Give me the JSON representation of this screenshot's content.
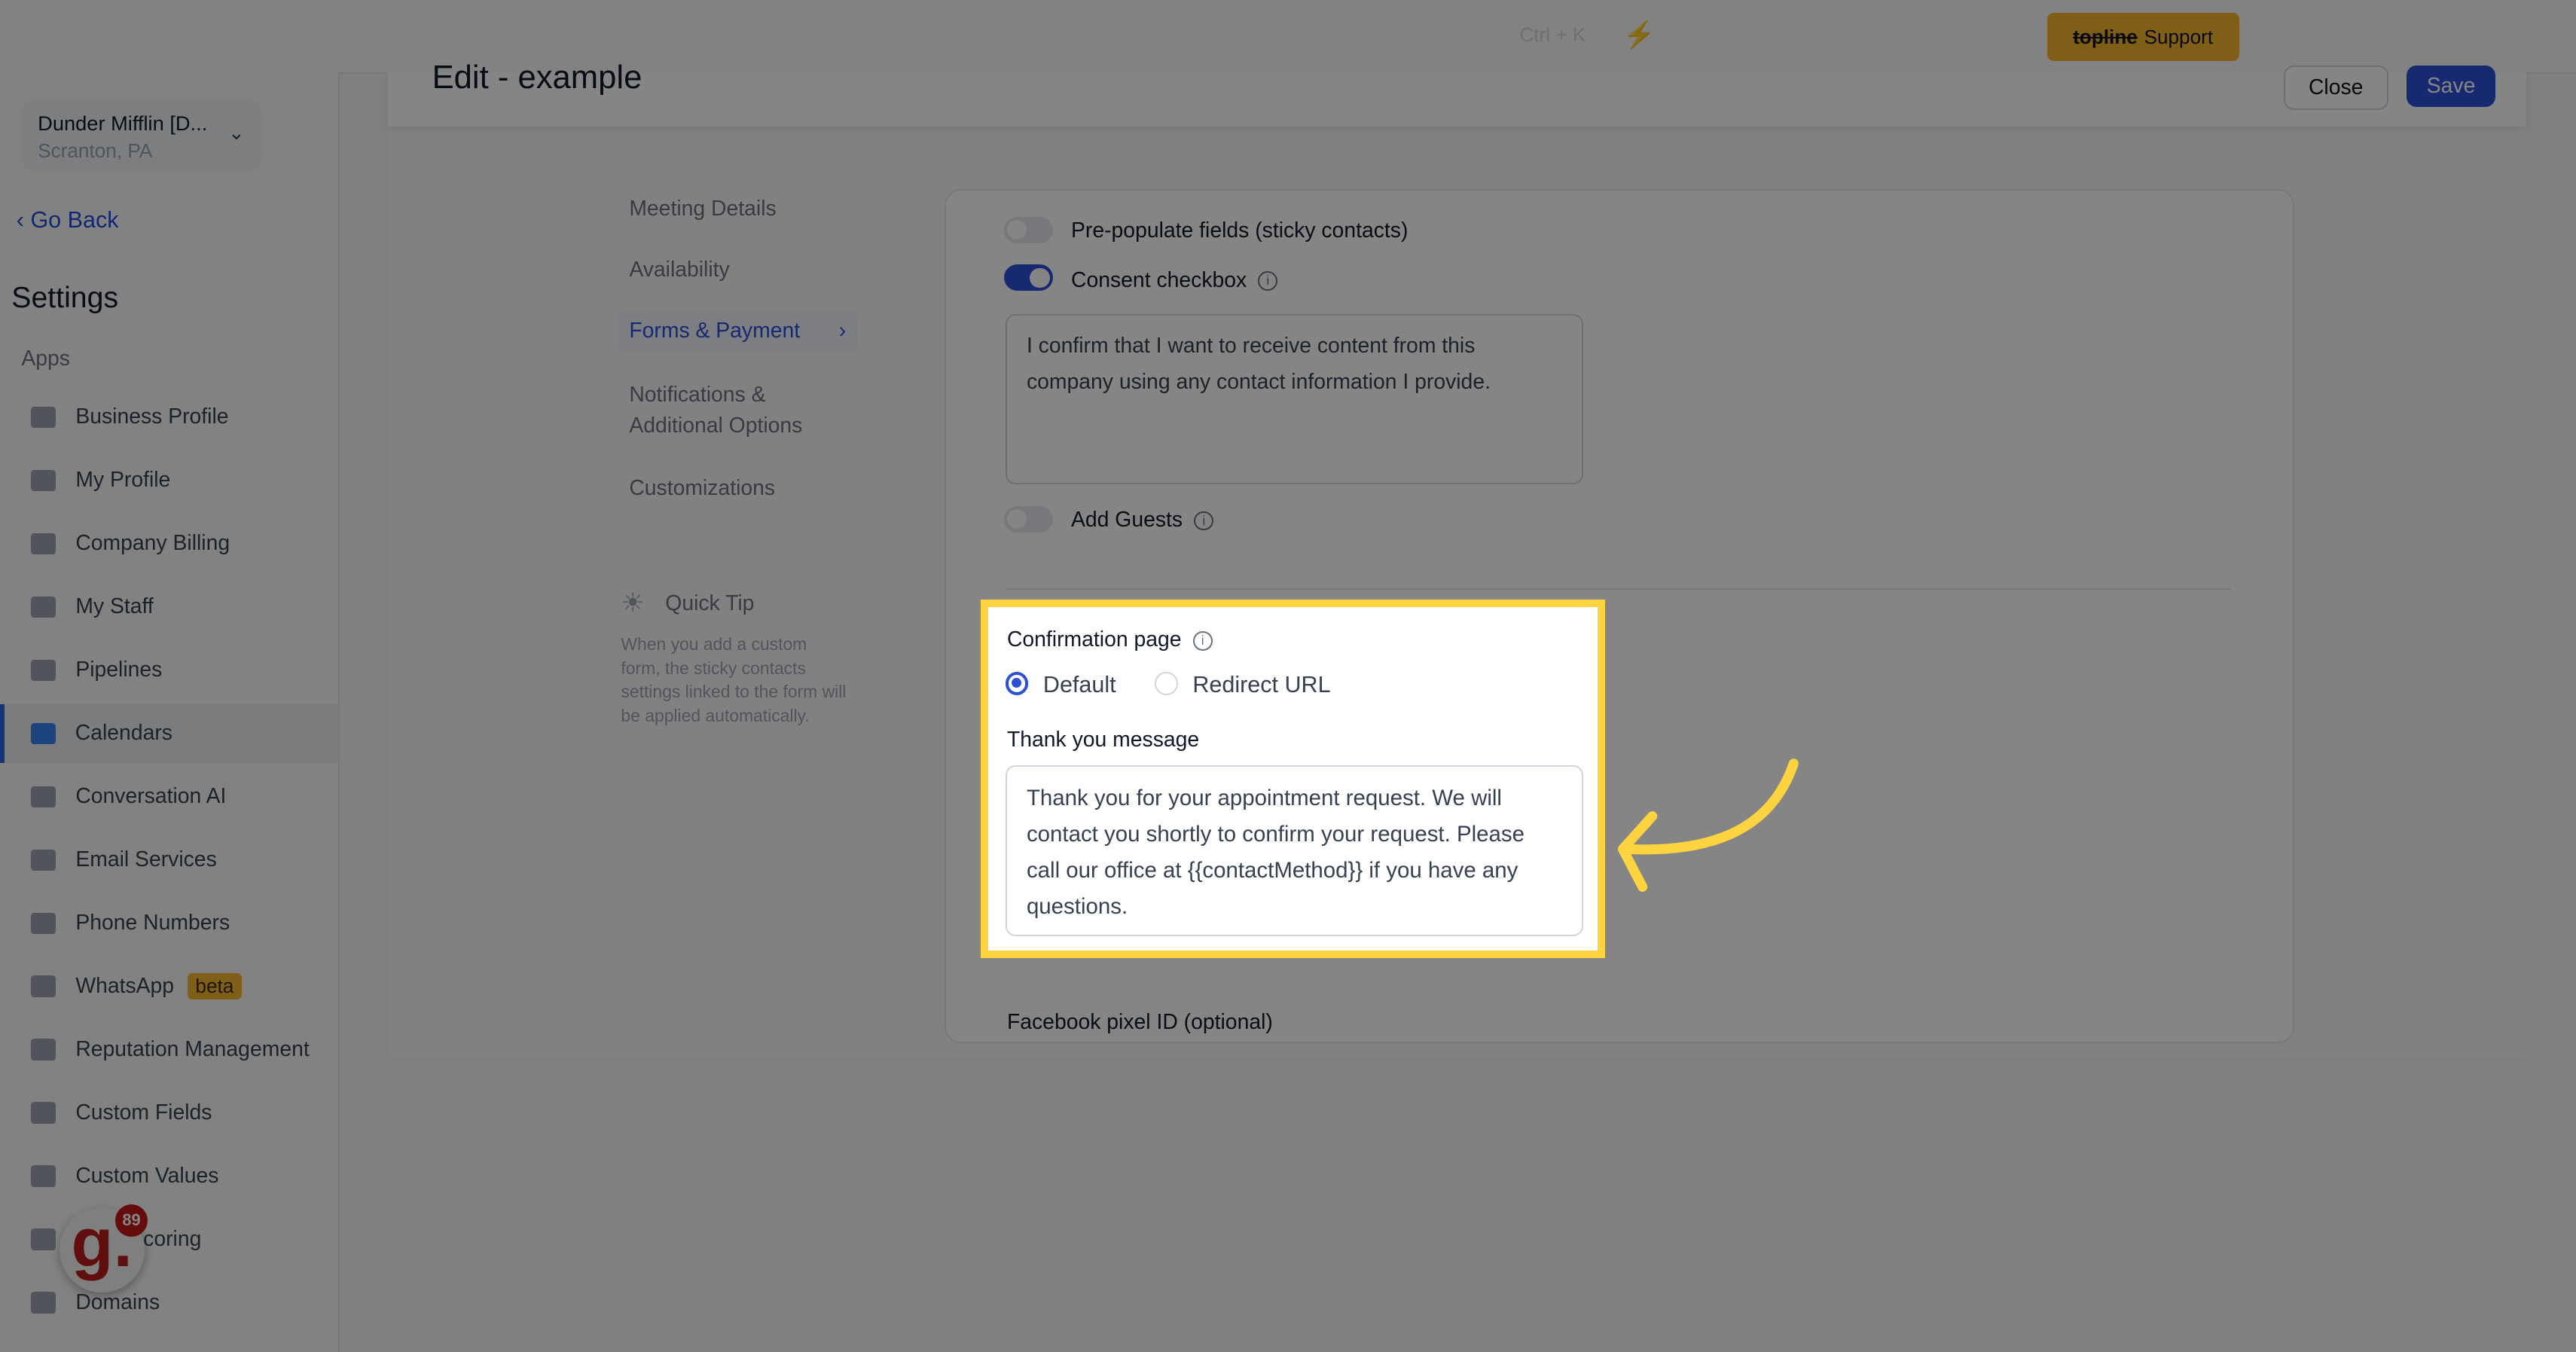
{
  "topbar": {
    "shortcut": "Ctrl + K",
    "support_strike": "topline",
    "support_label": "Support"
  },
  "account": {
    "name": "Dunder Mifflin [D...",
    "location": "Scranton, PA"
  },
  "sidebar": {
    "go_back": "Go Back",
    "title": "Settings",
    "section": "Apps",
    "items": [
      {
        "label": "Business Profile"
      },
      {
        "label": "My Profile"
      },
      {
        "label": "Company Billing"
      },
      {
        "label": "My Staff"
      },
      {
        "label": "Pipelines"
      },
      {
        "label": "Calendars",
        "active": true
      },
      {
        "label": "Conversation AI"
      },
      {
        "label": "Email Services"
      },
      {
        "label": "Phone Numbers"
      },
      {
        "label": "WhatsApp",
        "badge": "beta"
      },
      {
        "label": "Reputation Management"
      },
      {
        "label": "Custom Fields"
      },
      {
        "label": "Custom Values"
      },
      {
        "label": "Lead Scoring"
      },
      {
        "label": "Domains"
      }
    ]
  },
  "avatar": {
    "letter": "g.",
    "count": "89"
  },
  "header": {
    "title": "Edit - example",
    "close": "Close",
    "save": "Save"
  },
  "nav": [
    {
      "label": "Meeting Details"
    },
    {
      "label": "Availability"
    },
    {
      "label": "Forms & Payment",
      "active": true
    },
    {
      "label": "Notifications & Additional Options"
    },
    {
      "label": "Customizations"
    }
  ],
  "tip": {
    "title": "Quick Tip",
    "body": "When you add a custom form, the sticky contacts settings linked to the form will be applied automatically."
  },
  "form": {
    "prepopulate": {
      "label": "Pre-populate fields (sticky contacts)",
      "on": false
    },
    "consent": {
      "label": "Consent checkbox",
      "on": true,
      "text": "I confirm that I want to receive content from this company using any contact information I provide."
    },
    "guests": {
      "label": "Add Guests",
      "on": false
    },
    "confirmation": {
      "label": "Confirmation page",
      "options": [
        "Default",
        "Redirect URL"
      ],
      "selected": "Default"
    },
    "thankyou": {
      "label": "Thank you message",
      "text": "Thank you for your appointment request. We will contact you shortly to confirm your request. Please call our office at {{contactMethod}} if you have any questions."
    },
    "pixel": {
      "label": "Facebook pixel ID (optional)"
    }
  },
  "colors": {
    "accent": "#2d4fd6",
    "highlight": "#fdd33f",
    "support": "#f3b42d"
  }
}
